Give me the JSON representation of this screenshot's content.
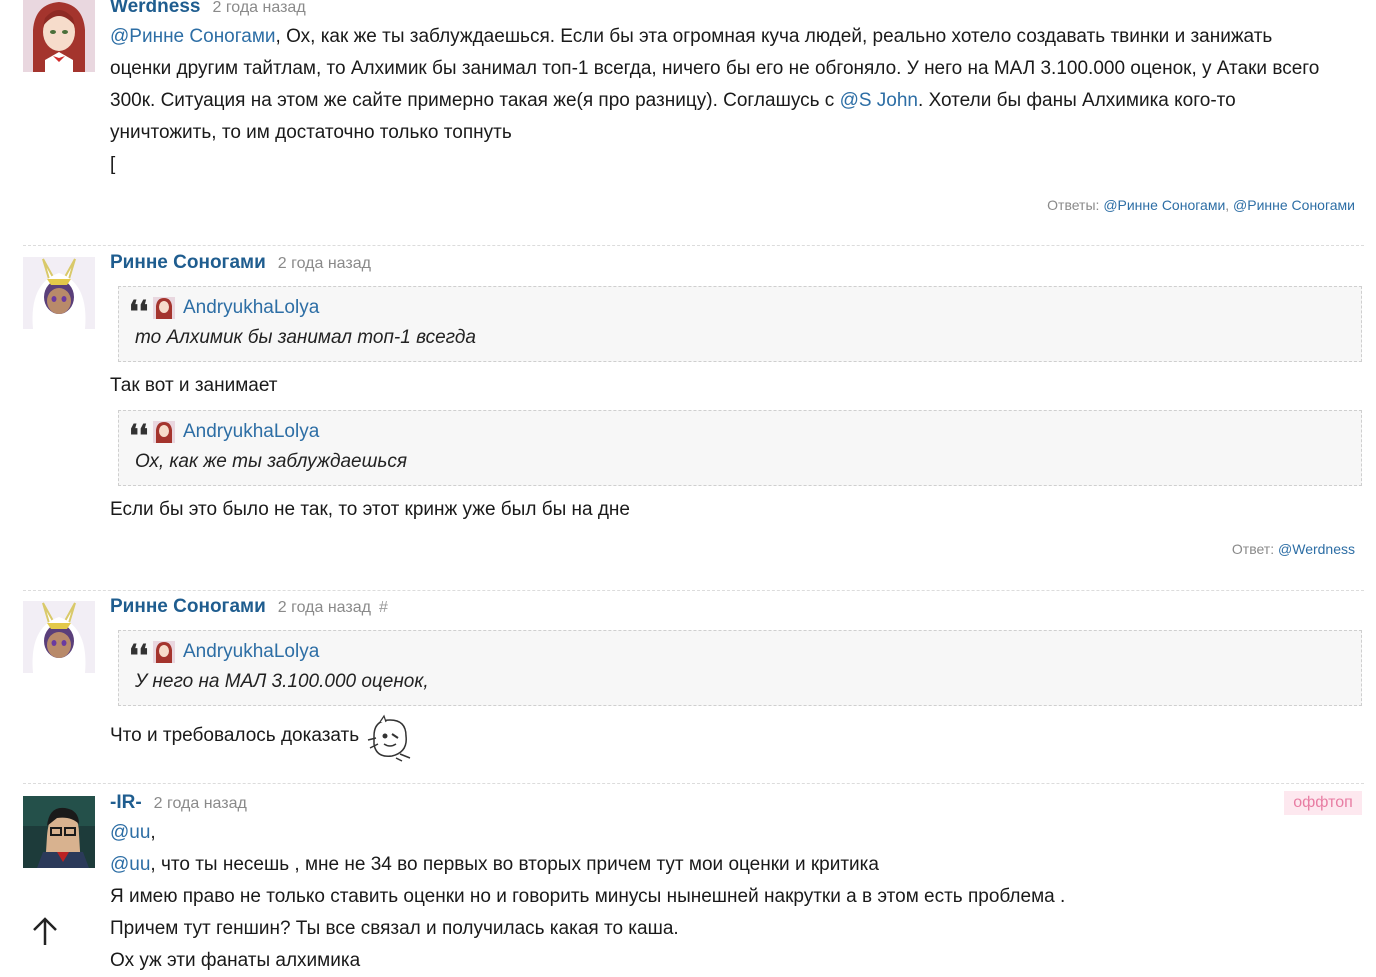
{
  "comments": [
    {
      "author": "Werdness",
      "time": "2 года назад",
      "lines": [
        [
          "@Ринне Соногами",
          ", Ох, как же ты заблуждаешься. Если бы эта огромная куча людей, реально хотело создавать твинки и занижать"
        ],
        "оценки другим тайтлам, то Алхимик бы занимал топ-1 всегда, ничего бы его не обгоняло. У него на МАЛ 3.100.000 оценок, у Атаки всего",
        [
          "300к. Ситуация на этом же сайте примерно такая же(я про разницу). Соглашусь с ",
          "@S John",
          ". Хотели бы фаны Алхимика кого-то"
        ],
        "уничтожить, то им достаточно только топнуть",
        "["
      ],
      "line3_post": ". Хотели бы фаны Алхимика кого-то",
      "replies_label": "Ответы:",
      "replies": [
        "@Ринне Соногами",
        "@Ринне Соногами"
      ],
      "replies_sep": ","
    },
    {
      "author": "Ринне Соногами",
      "time": "2 года назад",
      "quote1_author": "AndryukhaLolya",
      "quote1_text": "то Алхимик бы занимал топ-1 всегда",
      "text1": "Так вот и занимает",
      "quote2_author": "AndryukhaLolya",
      "quote2_text": "Ох, как же ты заблуждаешься",
      "text2": "Если бы это было не так, то этот кринж уже был бы на дне",
      "replies_label": "Ответ:",
      "replies": [
        "@Werdness"
      ]
    },
    {
      "author": "Ринне Соногами",
      "time": "2 года назад",
      "hash": "#",
      "quote_author": "AndryukhaLolya",
      "quote_text": "У него на МАЛ 3.100.000 оценок,",
      "text": "Что и требовалось доказать"
    },
    {
      "author": "-IR-",
      "time": "2 года назад",
      "badge": "оффтоп",
      "line1_mention": "@uu",
      "line1_post": ",",
      "line2_mention": "@uu",
      "line2_post": ", что ты несешь , мне не 34 во первых во вторых причем тут мои оценки и критика",
      "line3": "Я имею право не только ставить оценки но и говорить минусы нынешней накрутки а в этом есть проблема .",
      "line4": "Причем тут геншин? Ты все связал и получилась какая то каша.",
      "line5": "Ох уж эти фанаты алхимика"
    }
  ],
  "c0": {
    "l1_mention": "@Ринне Соногами",
    "l1_post": ", Ох, как же ты заблуждаешься. Если бы эта огромная куча людей, реально хотело создавать твинки и занижать",
    "l2": "оценки другим тайтлам, то Алхимик бы занимал топ-1 всегда, ничего бы его не обгоняло. У него на МАЛ 3.100.000 оценок, у Атаки всего",
    "l3_pre": "300к. Ситуация на этом же сайте примерно такая же(я про разницу). Соглашусь с ",
    "l3_mention": "@S John",
    "l3_post": ". Хотели бы фаны Алхимика кого-то",
    "l4": "уничтожить, то им достаточно только топнуть",
    "l5": "["
  },
  "icons": {
    "scroll_top": "arrow-up-icon",
    "quote": "quote-mark-icon",
    "sticker": "sticker-icon"
  }
}
